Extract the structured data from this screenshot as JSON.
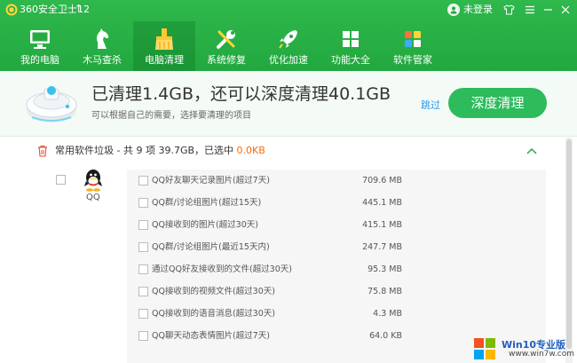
{
  "titlebar": {
    "app_title": "360安全卫士12",
    "user_name": "未登录"
  },
  "nav": {
    "items": [
      {
        "label": "我的电脑",
        "icon": "computer-icon"
      },
      {
        "label": "木马查杀",
        "icon": "horse-icon"
      },
      {
        "label": "电脑清理",
        "icon": "broom-icon",
        "active": true
      },
      {
        "label": "系统修复",
        "icon": "wrench-icon"
      },
      {
        "label": "优化加速",
        "icon": "rocket-icon"
      },
      {
        "label": "功能大全",
        "icon": "grid-icon"
      },
      {
        "label": "软件管家",
        "icon": "apps-icon"
      }
    ]
  },
  "banner": {
    "title": "已清理1.4GB，还可以深度清理40.1GB",
    "subtitle": "可以根据自己的需要，选择要清理的项目",
    "skip": "跳过",
    "deep_clean": "深度清理"
  },
  "section": {
    "title_prefix": "常用软件垃圾 - 共 9 项 39.7GB，已选中 ",
    "selected": "0.0KB",
    "app_name": "QQ",
    "items": [
      {
        "name": "QQ好友聊天记录图片(超过7天)",
        "size": "709.6 MB"
      },
      {
        "name": "QQ群/讨论组图片(超过15天)",
        "size": "445.1 MB"
      },
      {
        "name": "QQ接收到的图片(超过30天)",
        "size": "415.1 MB"
      },
      {
        "name": "QQ群/讨论组图片(最近15天内)",
        "size": "247.7 MB"
      },
      {
        "name": "通过QQ好友接收到的文件(超过30天)",
        "size": "95.3 MB"
      },
      {
        "name": "QQ接收到的视频文件(超过30天)",
        "size": "75.8 MB"
      },
      {
        "name": "QQ接收到的语音消息(超过30天)",
        "size": "4.3 MB"
      },
      {
        "name": "QQ聊天动态表情图片(超过7天)",
        "size": "64.0 KB"
      }
    ]
  },
  "watermark": {
    "title": "Win10专业版",
    "url": "www.win7w.com"
  },
  "colors": {
    "header_green": "#22a83f",
    "button_green": "#2dbb5c",
    "selected_orange": "#ff6a00",
    "link_blue": "#2a9cf0"
  }
}
